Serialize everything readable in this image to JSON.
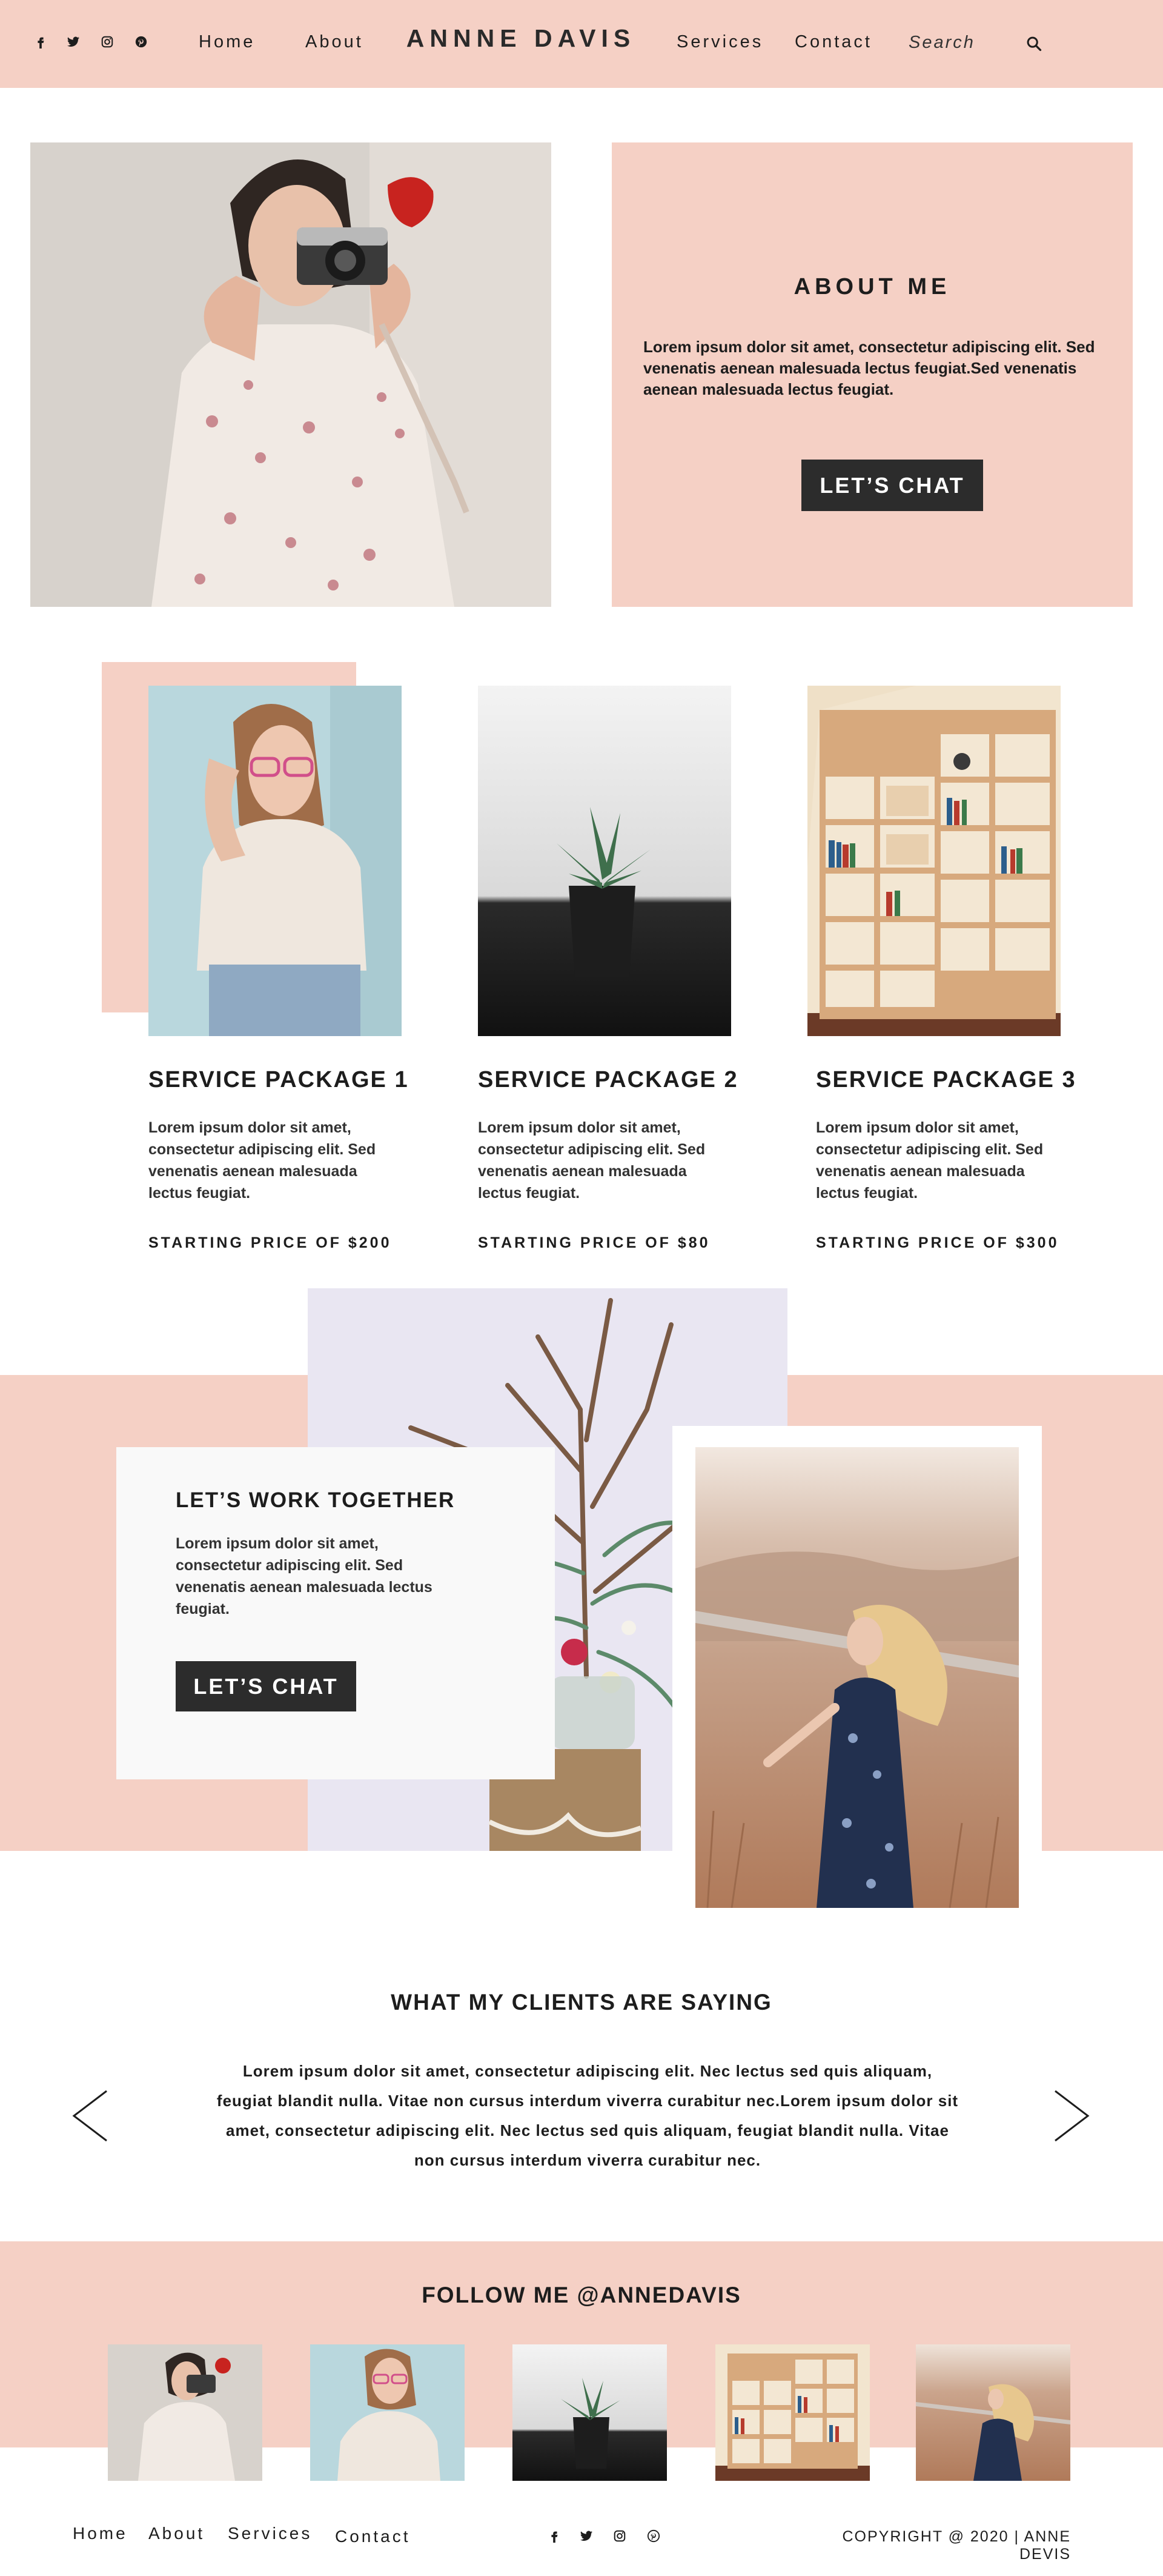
{
  "header": {
    "social_icons": [
      "facebook-icon",
      "twitter-icon",
      "instagram-icon",
      "pinterest-icon"
    ],
    "nav_left": [
      "Home",
      "About"
    ],
    "brand": "ANNNE DAVIS",
    "nav_right": [
      "Services",
      "Contact"
    ],
    "search_placeholder": "Search",
    "search_icon": "search-icon"
  },
  "about": {
    "image": "woman-with-camera-photo",
    "title": "ABOUT ME",
    "text": "Lorem ipsum dolor sit amet, consectetur adipiscing elit. Sed venenatis aenean malesuada lectus feugiat.Sed venenatis aenean malesuada lectus feugiat.",
    "button": "LET’S CHAT"
  },
  "services": [
    {
      "image": "woman-with-glasses-photo",
      "title": "SERVICE PACKAGE 1",
      "text": "Lorem ipsum dolor sit amet, consectetur adipiscing elit. Sed venenatis aenean malesuada lectus feugiat.",
      "price": "STARTING PRICE OF $200"
    },
    {
      "image": "succulent-plant-photo",
      "title": "SERVICE PACKAGE 2",
      "text": "Lorem ipsum dolor sit amet, consectetur adipiscing elit. Sed venenatis aenean malesuada lectus feugiat.",
      "price": "STARTING PRICE OF $80"
    },
    {
      "image": "bookshelf-photo",
      "title": "SERVICE PACKAGE 3",
      "text": "Lorem ipsum dolor sit amet, consectetur adipiscing elit. Sed venenatis aenean malesuada lectus feugiat.",
      "price": "STARTING PRICE OF $300"
    }
  ],
  "work": {
    "image_left": "dried-flowers-vase-photo",
    "image_right": "woman-in-field-photo",
    "title": "LET’S WORK TOGETHER",
    "text": "Lorem ipsum dolor sit amet, consectetur adipiscing elit. Sed venenatis aenean malesuada lectus feugiat.",
    "button": "LET’S CHAT"
  },
  "testimonials": {
    "title": "WHAT MY CLIENTS ARE SAYING",
    "text": "Lorem ipsum dolor sit amet, consectetur adipiscing elit. Nec lectus sed quis aliquam, feugiat blandit nulla. Vitae non cursus interdum viverra curabitur nec.Lorem ipsum dolor sit amet, consectetur adipiscing elit. Nec lectus sed quis aliquam, feugiat blandit nulla. Vitae non cursus interdum viverra curabitur nec.",
    "prev_icon": "chevron-left-icon",
    "next_icon": "chevron-right-icon"
  },
  "follow": {
    "title": "FOLLOW ME @ANNEDAVIS",
    "thumbnails": [
      "woman-with-camera-photo",
      "woman-with-glasses-photo",
      "succulent-plant-photo",
      "bookshelf-photo",
      "woman-in-field-photo"
    ]
  },
  "footer": {
    "links": [
      "Home",
      "About",
      "Services",
      "Contact"
    ],
    "social_icons": [
      "facebook-icon",
      "twitter-icon",
      "instagram-icon",
      "pinterest-icon"
    ],
    "copyright": "COPYRIGHT @ 2020 | ANNE DEVIS"
  },
  "colors": {
    "accent_pink": "#f5d0c5",
    "button_dark": "#2c2c2c",
    "card_white": "#f9f9f9"
  }
}
